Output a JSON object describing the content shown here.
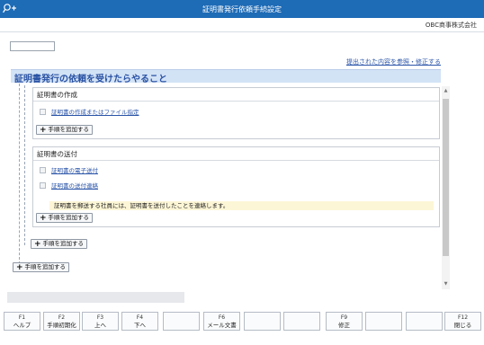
{
  "window": {
    "title": "証明書発行依頼手続設定",
    "company": "OBC商事株式会社"
  },
  "top": {
    "input_value": "",
    "reference_link": "提出された内容を参照・修正する"
  },
  "section": {
    "title": "証明書発行の依頼を受けたらやること"
  },
  "cards": [
    {
      "heading": "証明書の作成",
      "tasks": [
        "証明書の作成またはファイル指定"
      ],
      "add_label": "手順を追加する"
    },
    {
      "heading": "証明書の送付",
      "tasks": [
        "証明書の電子送付",
        "証明書の送付連絡"
      ],
      "note": "証明書を郵送する社員には、証明書を送付したことを連絡します。",
      "add_label": "手順を追加する"
    }
  ],
  "outer_add_label": "手順を追加する",
  "root_add_label": "手順を追加する",
  "function_keys": [
    {
      "key": "F1",
      "label": "ヘルプ"
    },
    {
      "key": "F2",
      "label": "手順初期化"
    },
    {
      "key": "F3",
      "label": "上へ"
    },
    {
      "key": "F4",
      "label": "下へ"
    },
    {
      "key": "",
      "label": ""
    },
    {
      "key": "F6",
      "label": "メール文書"
    },
    {
      "key": "",
      "label": ""
    },
    {
      "key": "",
      "label": ""
    },
    {
      "key": "F9",
      "label": "修正"
    },
    {
      "key": "",
      "label": ""
    },
    {
      "key": "",
      "label": ""
    },
    {
      "key": "F12",
      "label": "閉じる"
    }
  ]
}
